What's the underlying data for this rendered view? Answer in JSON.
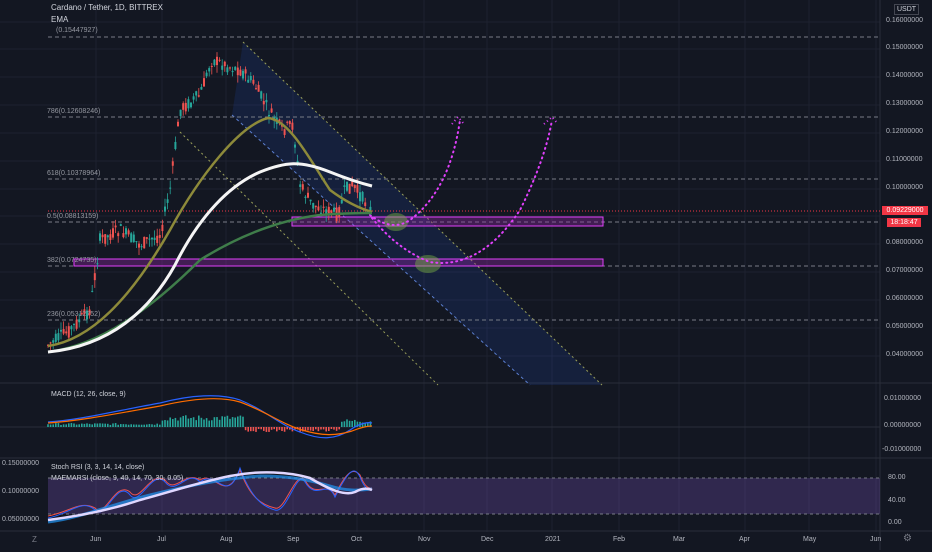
{
  "header": {
    "symbol": "Cardano / Tether, 1D, BITTREX",
    "ema_label": "EMA",
    "currency": "USDT"
  },
  "fib_levels": [
    {
      "label": "(0.15447927)",
      "price": 0.15448
    },
    {
      "label": "786(0.12608246)",
      "price": 0.12608
    },
    {
      "label": "618(0.10378964)",
      "price": 0.10379
    },
    {
      "label": "0.5(0.08813159)",
      "price": 0.08813
    },
    {
      "label": "382(0.0724735)",
      "price": 0.07247
    },
    {
      "label": "236(0.05312752)",
      "price": 0.05313
    }
  ],
  "price_axis": {
    "ticks": [
      "0.16000000",
      "0.15000000",
      "0.14000000",
      "0.13000000",
      "0.12000000",
      "0.11000000",
      "0.10000000",
      "0.09000000",
      "0.08000000",
      "0.07000000",
      "0.06000000",
      "0.05000000",
      "0.04000000"
    ],
    "current_price": "0.09229000",
    "countdown": "18:18:47"
  },
  "macd": {
    "label": "MACD (12, 26, close, 9)",
    "ticks": [
      "0.01000000",
      "0.00000000",
      "-0.01000000"
    ]
  },
  "oscillator": {
    "stoch_label": "Stoch RSI (3, 3, 14, 14, close)",
    "maemarsi_label": "MAEMARSI (close, 9, 40, 14, 70, 30, 0.05)",
    "left_ticks": [
      "0.15000000",
      "0.10000000",
      "0.05000000"
    ],
    "right_ticks": [
      "80.00",
      "40.00",
      "0.00"
    ]
  },
  "time_axis": [
    "Jun",
    "Jul",
    "Aug",
    "Sep",
    "Oct",
    "Nov",
    "Dec",
    "2021",
    "Feb",
    "Mar",
    "Apr",
    "May",
    "Jun"
  ],
  "colors": {
    "background": "#131722",
    "candle_up": "#26a69a",
    "candle_down": "#ef5350",
    "highlight_zone": "#9c27b0",
    "projection": "#e040fb",
    "price_tag": "#f23645",
    "ema_fast": "#f5f5f5",
    "ema_mid": "#8d8a3a",
    "ema_slow": "#3f7d4a"
  },
  "icons": {
    "bottom_left": "z-icon",
    "bottom_right": "gear-icon"
  }
}
